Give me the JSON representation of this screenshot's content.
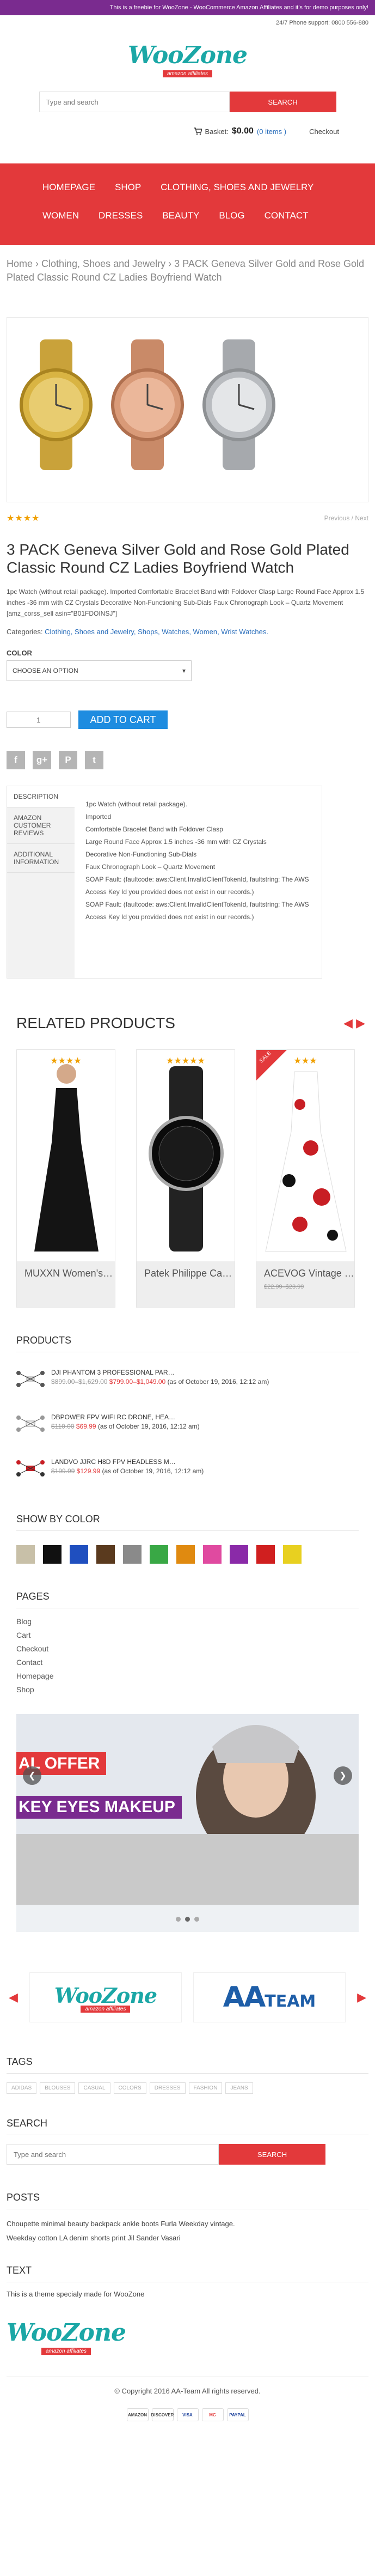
{
  "topbar": {
    "notice": "This is a freebie for WooZone - WooCommerce Amazon Affiliates and it's for demo purposes only!"
  },
  "header": {
    "support": "24/7 Phone support: 0800 556-880",
    "logo_word": "WooZone",
    "logo_sub": "amazon affiliates",
    "search_placeholder": "Type and search",
    "search_button": "SEARCH",
    "basket_label": "Basket:",
    "basket_amount": "$0.00",
    "basket_items": "(0 items )",
    "checkout": "Checkout"
  },
  "nav": {
    "items": [
      "HOMEPAGE",
      "SHOP",
      "CLOTHING, SHOES AND JEWELRY",
      "WOMEN",
      "DRESSES",
      "BEAUTY",
      "BLOG",
      "CONTACT"
    ]
  },
  "breadcrumb": {
    "home": "Home",
    "cat": "Clothing, Shoes and Jewelry",
    "current": "3 PACK Geneva Silver Gold and Rose Gold Plated Classic Round CZ Ladies Boyfriend Watch"
  },
  "product": {
    "stars": "★★★★",
    "prevnext": "Previous / Next",
    "title": "3 PACK Geneva Silver Gold and Rose Gold Plated Classic Round CZ Ladies Boyfriend Watch",
    "description": "1pc Watch (without retail package). Imported Comfortable Bracelet Band with Foldover Clasp Large Round Face Approx 1.5 inches -36 mm with CZ Crystals Decorative Non-Functioning Sub-Dials Faux Chronograph Look – Quartz Movement [amz_corss_sell asin=\"B01FDOINSJ\"]",
    "categories_label": "Categories:",
    "categories": "Clothing, Shoes and Jewelry, Shops, Watches, Women, Wrist Watches.",
    "color_label": "COLOR",
    "select_default": "CHOOSE AN OPTION",
    "qty": "1",
    "add_to_cart": "ADD TO CART",
    "colors": {
      "gold": "#d9b443",
      "rose": "#d99a78",
      "silver": "#b9bcc0"
    }
  },
  "tabs": {
    "labels": [
      "DESCRIPTION",
      "AMAZON CUSTOMER REVIEWS",
      "ADDITIONAL INFORMATION"
    ],
    "lines": [
      "1pc Watch (without retail package).",
      "Imported",
      "Comfortable Bracelet Band with Foldover Clasp",
      "Large Round Face Approx 1.5 inches -36 mm with CZ Crystals",
      "Decorative Non-Functioning Sub-Dials",
      "Faux Chronograph Look – Quartz Movement",
      "SOAP Fault: (faultcode: aws:Client.InvalidClientTokenId, faultstring: The AWS Access Key Id you provided does not exist in our records.)",
      "SOAP Fault: (faultcode: aws:Client.InvalidClientTokenId, faultstring: The AWS Access Key Id you provided does not exist in our records.)"
    ]
  },
  "related": {
    "title": "RELATED PRODUCTS",
    "items": [
      {
        "name": "MUXXN Women's…",
        "stars": "★★★★",
        "price": ""
      },
      {
        "name": "Patek Philippe Ca…",
        "stars": "★★★★★",
        "price": ""
      },
      {
        "name": "ACEVOG Vintage …",
        "stars": "★★★",
        "price": "$22.99–$23.99",
        "sale": "SALE"
      }
    ]
  },
  "products_widget": {
    "title": "PRODUCTS",
    "items": [
      {
        "name": "DJI PHANTOM 3 PROFESSIONAL PAR…",
        "old": "$899.00–$1,629.00",
        "new": "$799.00–$1,049.00",
        "date": "(as of October 19, 2016, 12:12 am)"
      },
      {
        "name": "DBPOWER FPV WIFI RC DRONE, HEA…",
        "old": "$110.00",
        "new": "$69.99",
        "date": "(as of October 19, 2016, 12:12 am)"
      },
      {
        "name": "LANDVO JJRC H8D FPV HEADLESS M…",
        "old": "$199.99",
        "new": "$129.99",
        "date": "(as of October 19, 2016, 12:12 am)"
      }
    ]
  },
  "color_widget": {
    "title": "SHOW BY COLOR",
    "swatches": [
      "#c8c0a8",
      "#111111",
      "#1f4fbf",
      "#5a3a1e",
      "#8a8a8a",
      "#39a845",
      "#e08a10",
      "#e04aa0",
      "#8a2aa8",
      "#d01f1f",
      "#e8d020"
    ]
  },
  "pages": {
    "title": "PAGES",
    "items": [
      "Blog",
      "Cart",
      "Checkout",
      "Contact",
      "Homepage",
      "Shop"
    ]
  },
  "slider": {
    "tag1": "AL OFFER",
    "tag2": "KEY EYES MAKEUP"
  },
  "partners": {
    "aa_text": "AA",
    "aa_small": "TEAM"
  },
  "tags_widget": {
    "title": "TAGS",
    "items": [
      "ADIDAS",
      "BLOUSES",
      "CASUAL",
      "COLORS",
      "DRESSES",
      "FASHION",
      "JEANS"
    ]
  },
  "footer_search": {
    "title": "SEARCH",
    "placeholder": "Type and search",
    "button": "SEARCH"
  },
  "posts": {
    "title": "POSTS",
    "items": [
      "Choupette minimal beauty backpack ankle boots Furla Weekday vintage.",
      "Weekday cotton LA denim shorts print Jil Sander Vasari"
    ]
  },
  "text_widget": {
    "title": "TEXT",
    "body": "This is a theme specialy made for WooZone"
  },
  "footer": {
    "copyright": "© Copyright 2016 AA-Team All rights reserved.",
    "payments": [
      "AMAZON",
      "DISCOVER",
      "VISA",
      "MC",
      "PAYPAL"
    ]
  }
}
